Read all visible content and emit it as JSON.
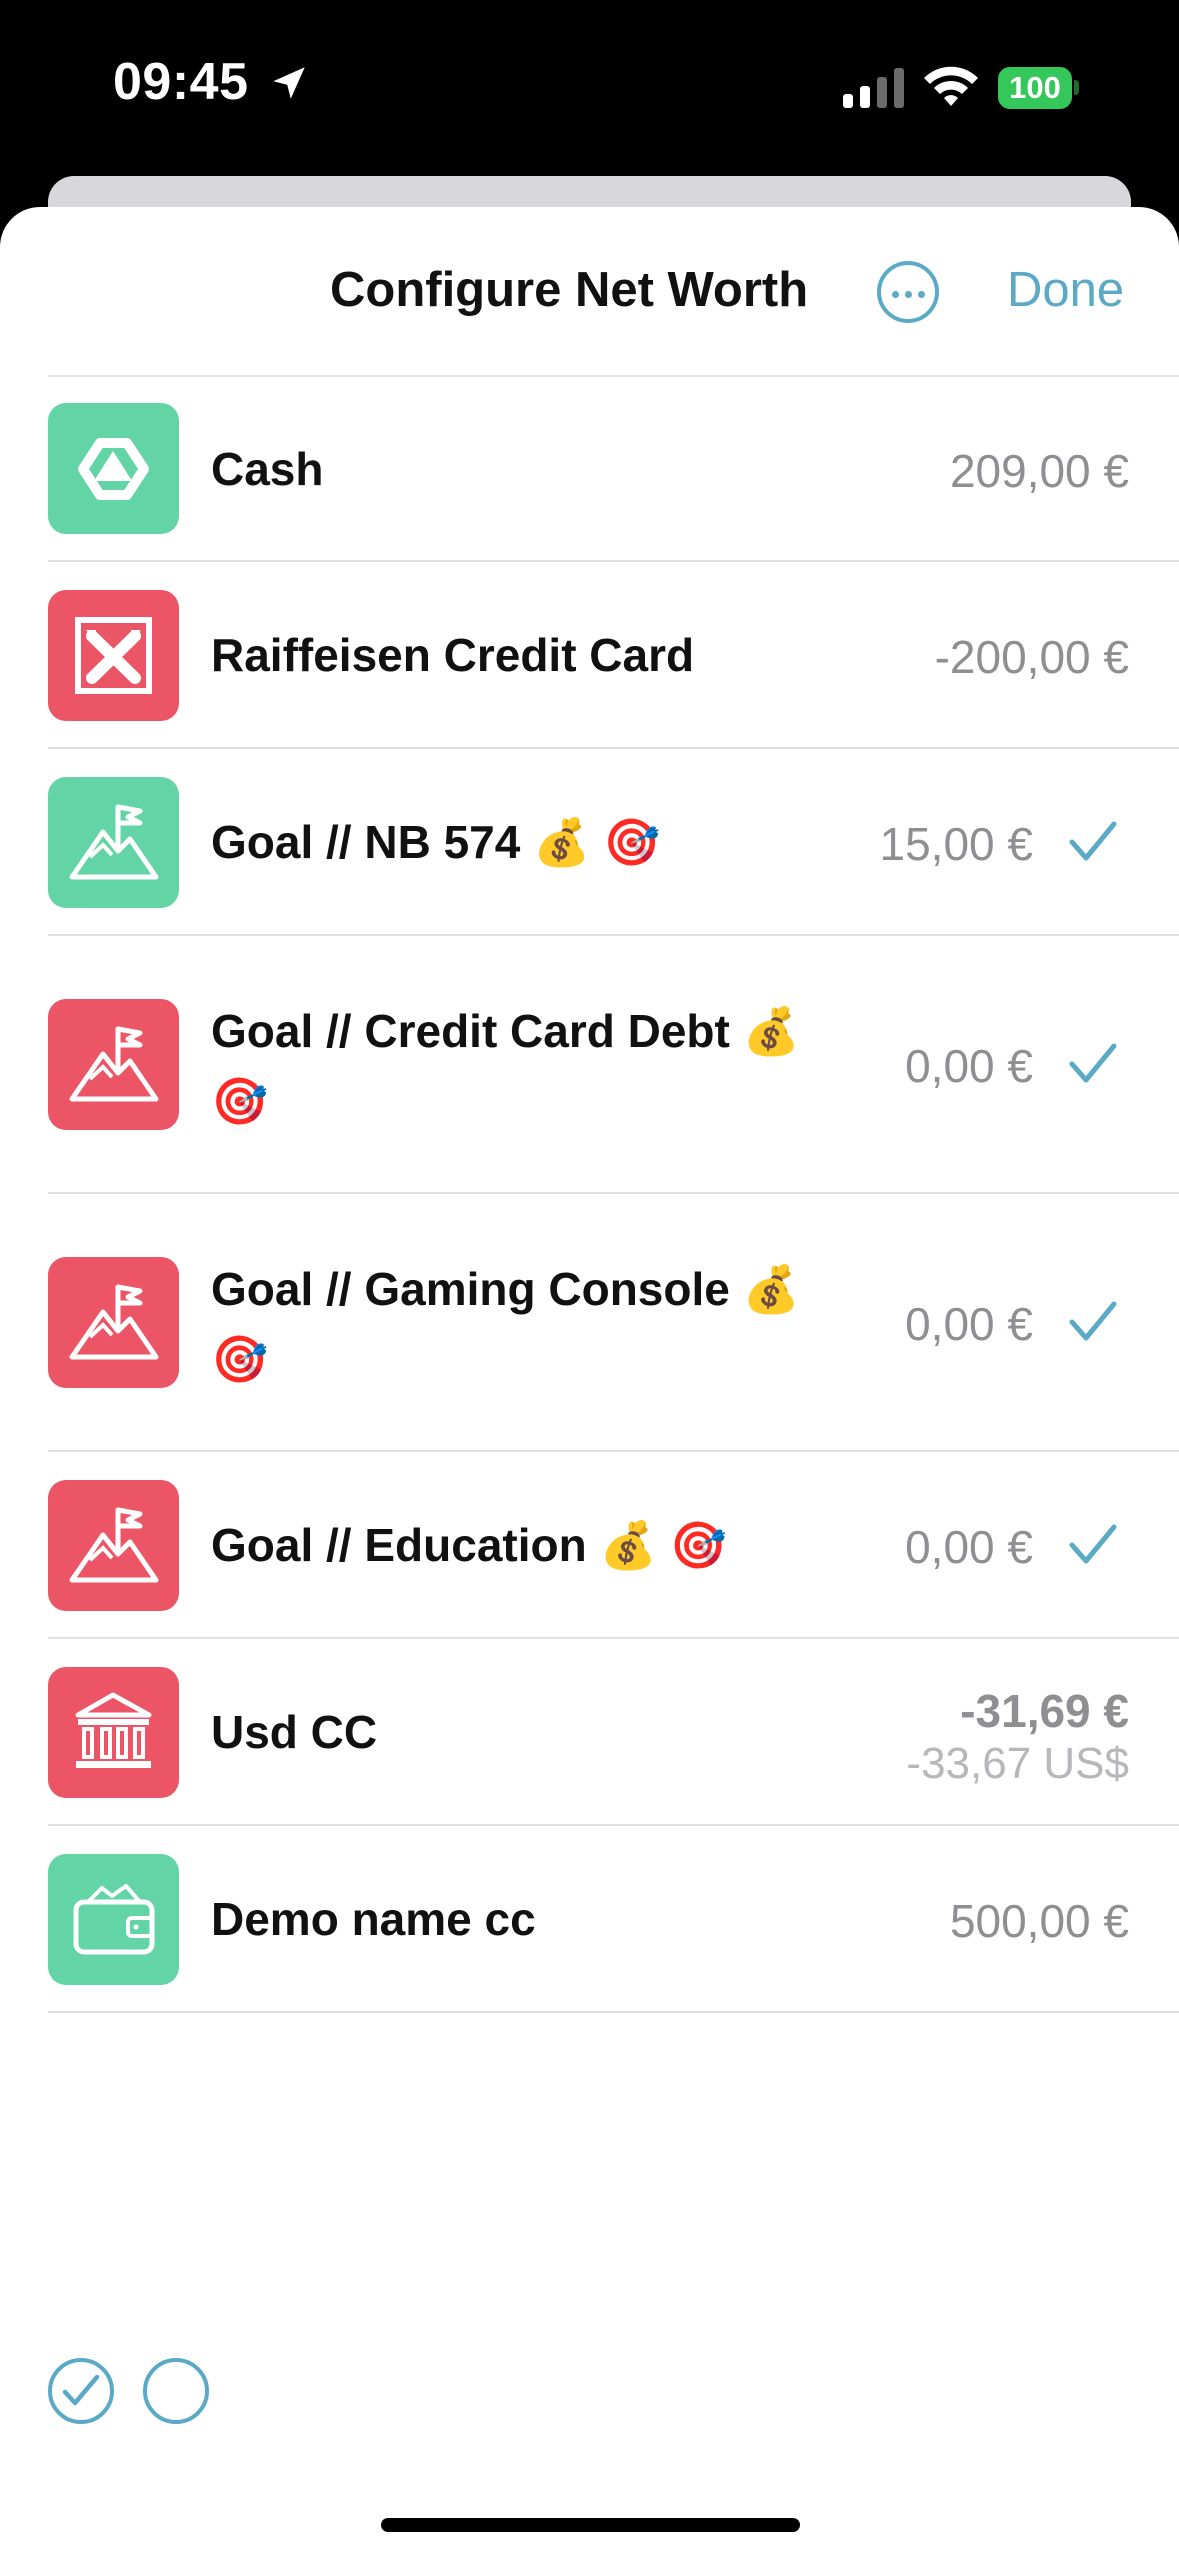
{
  "status": {
    "time": "09:45",
    "battery": "100"
  },
  "header": {
    "title": "Configure Net Worth",
    "done_label": "Done"
  },
  "accounts": [
    {
      "name": "Cash",
      "amount": "209,00 €"
    },
    {
      "name": "Raiffeisen Credit Card",
      "amount": "-200,00 €"
    },
    {
      "name": "Goal // NB 574 💰 🎯",
      "amount": "15,00 €"
    },
    {
      "name": "Goal // Credit Card Debt 💰 🎯",
      "amount": "0,00 €"
    },
    {
      "name": "Goal // Gaming Console 💰 🎯",
      "amount": "0,00 €"
    },
    {
      "name": "Goal // Education 💰 🎯",
      "amount": "0,00 €"
    },
    {
      "name": "Usd CC",
      "amount": "-31,69 €",
      "secondary_amount": "-33,67 US$"
    },
    {
      "name": "Demo name cc",
      "amount": "500,00 €"
    }
  ],
  "colors": {
    "accent": "#5aa9c6",
    "green": "#63d4a6",
    "red": "#ec5565"
  },
  "icons": [
    "location-arrow-icon",
    "signal-icon",
    "wifi-icon",
    "battery-icon",
    "more-icon",
    "check-icon",
    "bank-icon",
    "goal-flag-icon",
    "wallet-icon"
  ]
}
